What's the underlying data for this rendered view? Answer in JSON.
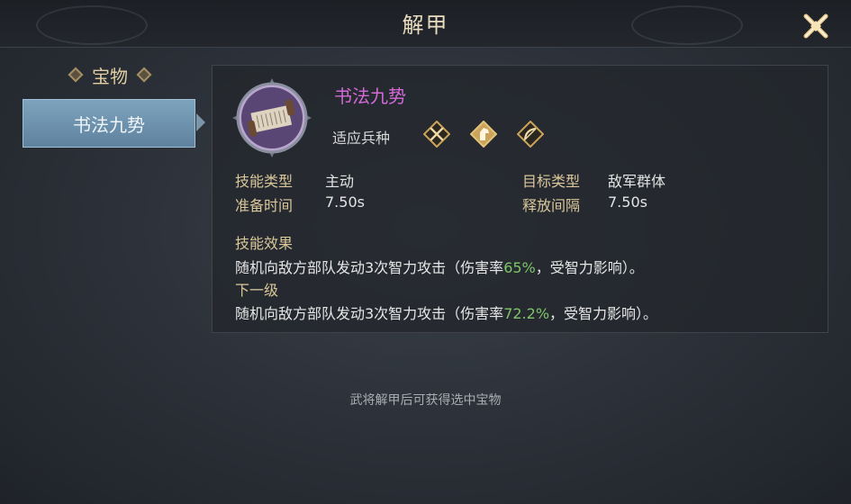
{
  "window": {
    "title": "解甲"
  },
  "sidebar": {
    "header": "宝物",
    "items": [
      {
        "label": "书法九势",
        "selected": true
      }
    ]
  },
  "skill": {
    "name": "书法九势",
    "troop_label": "适应兵种",
    "troop_icons": [
      "crossed-spears-icon",
      "horse-icon",
      "bow-icon"
    ],
    "stats": [
      {
        "label": "技能类型",
        "value": "主动"
      },
      {
        "label": "目标类型",
        "value": "敌军群体"
      },
      {
        "label": "准备时间",
        "value": "7.50s"
      },
      {
        "label": "释放间隔",
        "value": "7.50s"
      }
    ],
    "effect_title": "技能效果",
    "effect": {
      "prefix": "随机向敌方部队发动3次智力攻击（伤害率",
      "rate": "65%",
      "suffix": "，受智力影响）。"
    },
    "next_title": "下一级",
    "next": {
      "prefix": "随机向敌方部队发动3次智力攻击（伤害率",
      "rate": "72.2%",
      "suffix": "，受智力影响）。"
    }
  },
  "footer": {
    "note": "武将解甲后可获得选中宝物"
  },
  "colors": {
    "skill_name": "#d46ad8",
    "label_gold": "#d9c79a",
    "rate_green": "#7fc46a",
    "selected_tab": "#6f93ae"
  }
}
